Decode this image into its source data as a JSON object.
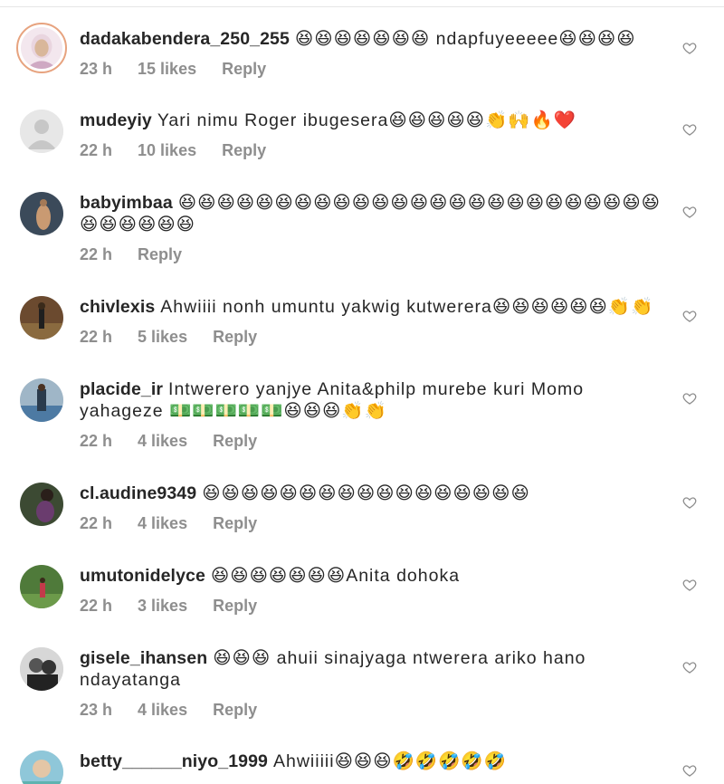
{
  "comments": [
    {
      "username": "dadakabendera_250_255",
      "text": "😆😆😆😆😆😆😆 ndapfuyeeeee😆😆😆😆",
      "time": "23 h",
      "likes": "15 likes",
      "reply": "Reply",
      "avatar": "story-avatar-woman"
    },
    {
      "username": "mudeyiy",
      "text": "Yari nimu Roger ibugesera😆😆😆😆😆👏🙌🔥❤️",
      "time": "22 h",
      "likes": "10 likes",
      "reply": "Reply",
      "avatar": "default-avatar"
    },
    {
      "username": "babyimbaa",
      "text": "😆😆😆😆😆😆😆😆😆😆😆😆😆😆😆😆😆😆😆😆😆😆😆😆😆😆😆😆😆😆😆",
      "time": "22 h",
      "likes": "",
      "reply": "Reply",
      "avatar": "photo-avatar"
    },
    {
      "username": "chivlexis",
      "text": "Ahwiiii nonh umuntu yakwig kutwerera😆😆😆😆😆😆👏👏",
      "time": "22 h",
      "likes": "5 likes",
      "reply": "Reply",
      "avatar": "photo-avatar"
    },
    {
      "username": "placide_ir",
      "text": "Intwerero yanjye Anita&philp murebe kuri Momo yahageze 💵💵💵💵💵😆😆😆👏👏",
      "time": "22 h",
      "likes": "4 likes",
      "reply": "Reply",
      "avatar": "photo-avatar"
    },
    {
      "username": "cl.audine9349",
      "text": "😆😆😆😆😆😆😆😆😆😆😆😆😆😆😆😆😆",
      "time": "22 h",
      "likes": "4 likes",
      "reply": "Reply",
      "avatar": "photo-avatar"
    },
    {
      "username": "umutonidelyce",
      "text": "😆😆😆😆😆😆😆Anita dohoka",
      "time": "22 h",
      "likes": "3 likes",
      "reply": "Reply",
      "avatar": "photo-avatar"
    },
    {
      "username": "gisele_ihansen",
      "text": "😆😆😆 ahuii sinajyaga ntwerera ariko hano ndayatanga",
      "time": "23 h",
      "likes": "4 likes",
      "reply": "Reply",
      "avatar": "photo-avatar"
    },
    {
      "username": "betty______niyo_1999",
      "text": "Ahwiiiii😆😆😆🤣🤣🤣🤣🤣",
      "time": "",
      "likes": "",
      "reply": "",
      "avatar": "photo-avatar"
    }
  ],
  "colors": {
    "text": "#262626",
    "meta": "#8e8e8e",
    "heart": "#8e8e8e",
    "story_ring": "#e7a37f"
  },
  "icons": {
    "like": "heart-outline-icon"
  }
}
